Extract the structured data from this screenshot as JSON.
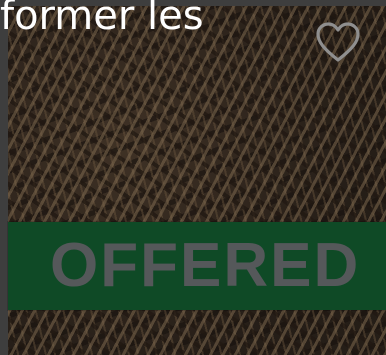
{
  "caption": {
    "text": "former les"
  },
  "listing": {
    "status_banner": "OFFERED",
    "favorite_icon": "heart-outline-icon",
    "image_description": "wood-chip-mulch-photo"
  },
  "colors": {
    "banner_green": "#0f4a26",
    "banner_text": "#55585a",
    "caption_text": "#ffffff"
  }
}
